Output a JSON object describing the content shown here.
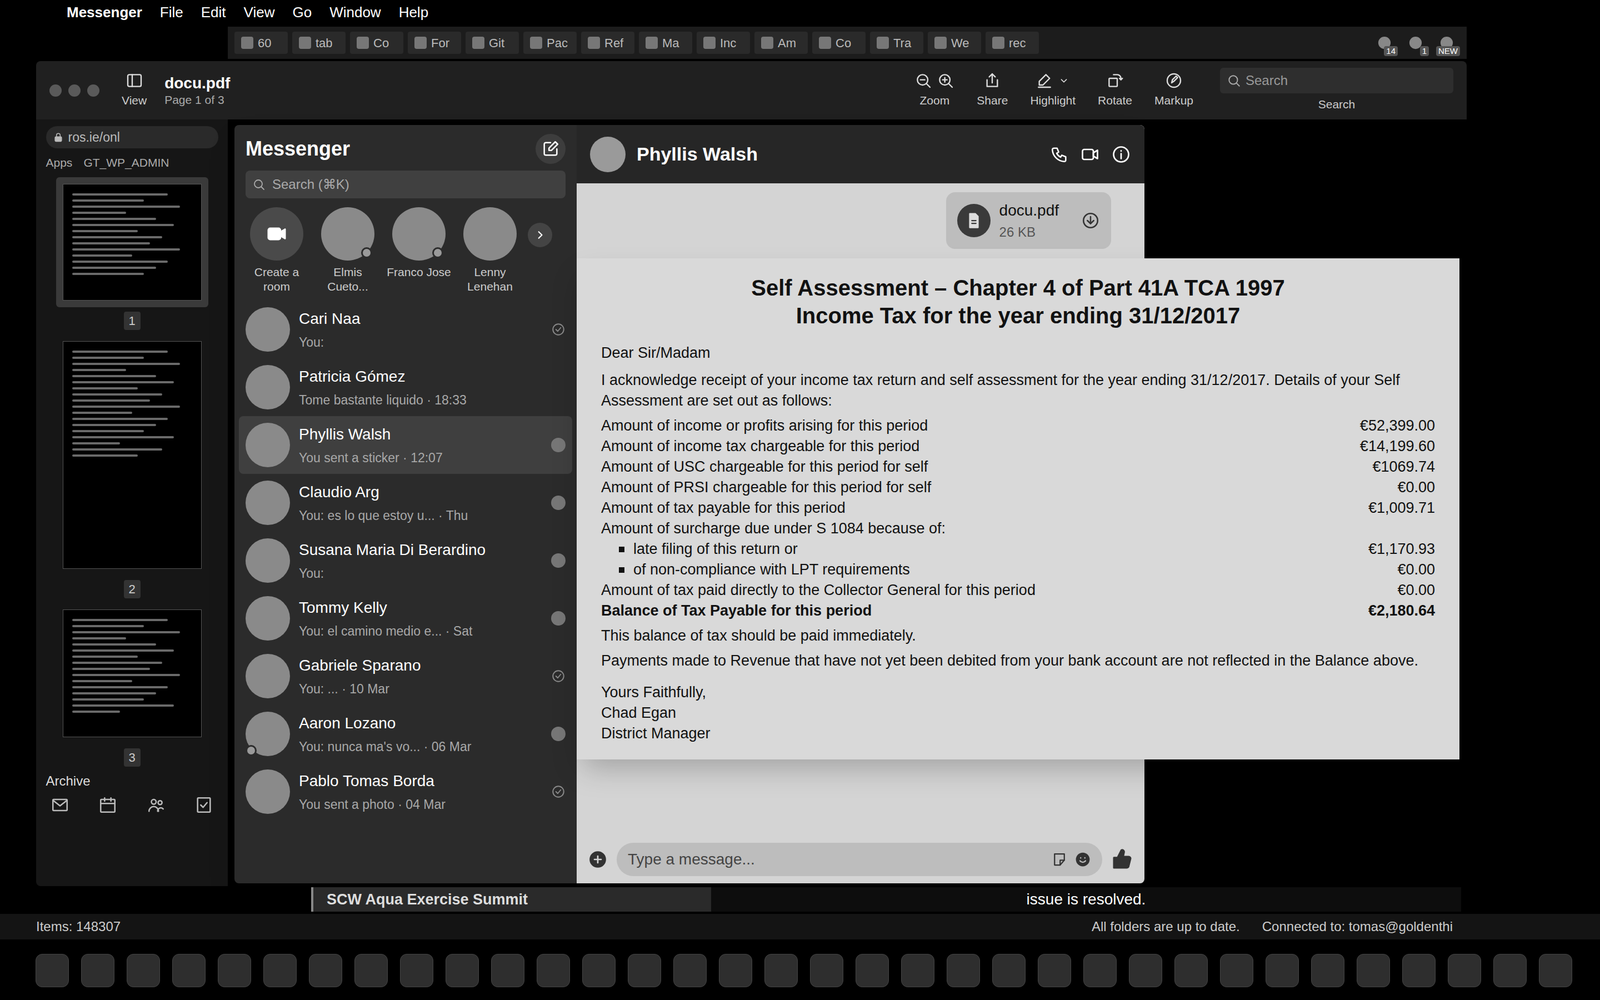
{
  "menu_bar": {
    "app": "Messenger",
    "items": [
      "File",
      "Edit",
      "View",
      "Go",
      "Window",
      "Help"
    ]
  },
  "browser": {
    "tabs": [
      "60",
      "tab",
      "Co",
      "For",
      "Git",
      "Pac",
      "Ref",
      "Ma",
      "Inc",
      "Am",
      "Co",
      "Tra",
      "We",
      "rec"
    ],
    "badges": [
      "14",
      "1",
      "NEW"
    ],
    "address": "ros.ie/onl",
    "bookmarks": [
      "Apps",
      "GT_WP_ADMIN"
    ]
  },
  "preview": {
    "title": "docu.pdf",
    "page": "Page 1 of 3",
    "tools": [
      {
        "label": "View",
        "kind": "sidebar"
      },
      {
        "label": "Zoom",
        "kind": "zoom"
      },
      {
        "label": "Share",
        "kind": "share"
      },
      {
        "label": "Highlight",
        "kind": "highlight"
      },
      {
        "label": "Rotate",
        "kind": "rotate"
      },
      {
        "label": "Markup",
        "kind": "markup"
      }
    ],
    "search": {
      "placeholder": "Search",
      "label": "Search"
    },
    "thumbnails": [
      {
        "label": "1",
        "selected": true
      },
      {
        "label": "2",
        "selected": false
      },
      {
        "label": "3",
        "selected": false
      }
    ]
  },
  "outlook": {
    "folder": "Archive",
    "nav": [
      {
        "kind": "mail"
      },
      {
        "kind": "calendar"
      },
      {
        "kind": "people"
      },
      {
        "kind": "tasks"
      }
    ],
    "items": "Items: 148307",
    "sync": "All folders are up to date.",
    "connection": "Connected to: tomas@goldenthi",
    "event": "SCW Aqua Exercise Summit",
    "notice": "issue is resolved."
  },
  "messenger": {
    "title": "Messenger",
    "search": {
      "placeholder": "Search (⌘K)"
    },
    "stories": [
      {
        "name": "Create a room",
        "kind": "create",
        "online": false
      },
      {
        "name": "Elmis Cueto...",
        "kind": "person",
        "online": true
      },
      {
        "name": "Franco Jose",
        "kind": "person",
        "online": true
      },
      {
        "name": "Lenny Lenehan",
        "kind": "person",
        "online": false
      }
    ],
    "conversations": [
      {
        "name": "Cari Naa",
        "preview": "You:",
        "selected": false,
        "online": false,
        "receipt": "sent"
      },
      {
        "name": "Patricia Gómez",
        "preview": "Tome bastante liquido · 18:33",
        "selected": false,
        "online": false,
        "receipt": "none"
      },
      {
        "name": "Phyllis Walsh",
        "preview": "You sent a sticker · 12:07",
        "selected": true,
        "online": false,
        "receipt": "seen"
      },
      {
        "name": "Claudio Arg",
        "preview": "You: es lo que estoy u... · Thu",
        "selected": false,
        "online": false,
        "receipt": "seen"
      },
      {
        "name": "Susana Maria Di Berardino",
        "preview": "You:",
        "selected": false,
        "online": false,
        "receipt": "seen"
      },
      {
        "name": "Tommy Kelly",
        "preview": "You: el camino medio e... · Sat",
        "selected": false,
        "online": false,
        "receipt": "seen"
      },
      {
        "name": "Gabriele Sparano",
        "preview": "You: ... · 10 Mar",
        "selected": false,
        "online": false,
        "receipt": "sent"
      },
      {
        "name": "Aaron Lozano",
        "preview": "You: nunca ma's vo... · 06 Mar",
        "selected": false,
        "online": true,
        "receipt": "seen"
      },
      {
        "name": "Pablo Tomas Borda",
        "preview": "You sent a photo · 04 Mar",
        "selected": false,
        "online": false,
        "receipt": "sent"
      }
    ],
    "chat": {
      "contact": "Phyllis Walsh",
      "messages": [
        {
          "kind": "file",
          "name": "docu.pdf",
          "size": "26 KB"
        }
      ],
      "composer": {
        "placeholder": "Type a message..."
      }
    }
  },
  "letter": {
    "title": [
      "Self Assessment – Chapter 4 of Part 41A TCA 1997",
      "Income Tax for the year ending 31/12/2017"
    ],
    "salutation": "Dear Sir/Madam",
    "intro": "I acknowledge receipt of your income tax return and self assessment for the year ending 31/12/2017.  Details of your Self Assessment are set out as follows:",
    "rows": [
      {
        "kind": "line",
        "label": "Amount of  income or profits arising for this period",
        "amount": "€52,399.00",
        "bold": false
      },
      {
        "kind": "line",
        "label": "Amount of income tax chargeable for this period",
        "amount": "€14,199.60",
        "bold": false
      },
      {
        "kind": "line",
        "label": "Amount of USC chargeable for this period for self",
        "amount": "€1069.74",
        "bold": false
      },
      {
        "kind": "line",
        "label": "Amount of PRSI chargeable for this period for self",
        "amount": "€0.00",
        "bold": false
      },
      {
        "kind": "line",
        "label": "Amount of tax payable for this period",
        "amount": "€1,009.71",
        "bold": false
      },
      {
        "kind": "heading",
        "label": "Amount of surcharge due under S 1084 because of:",
        "bold": false
      },
      {
        "kind": "bullet",
        "label": "late filing of this return or",
        "amount": "€1,170.93",
        "bold": false
      },
      {
        "kind": "bullet",
        "label": "of non-compliance with LPT requirements",
        "amount": "€0.00",
        "bold": false
      },
      {
        "kind": "line",
        "label": "Amount of tax paid directly to the Collector General for this period",
        "amount": "€0.00",
        "bold": false
      },
      {
        "kind": "line",
        "label": "Balance of Tax Payable for this period",
        "amount": "€2,180.64",
        "bold": true
      }
    ],
    "notes": [
      "This balance of tax should be paid immediately.",
      "Payments made to Revenue that have not yet been debited from your bank account are not reflected in the Balance above."
    ],
    "closing": [
      "Yours Faithfully,",
      "Chad Egan",
      "District Manager"
    ]
  }
}
